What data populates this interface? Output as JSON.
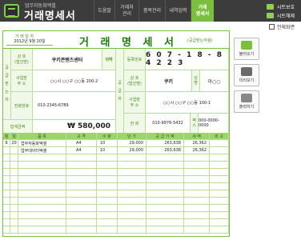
{
  "app": {
    "subtitle": "업무자동화엑셀",
    "title": "거래명세서"
  },
  "nav": {
    "tabs": [
      {
        "label": "도움말"
      },
      {
        "label": "거래처\n관리"
      },
      {
        "label": "품목관리"
      },
      {
        "label": "내역입력"
      },
      {
        "label": "거래\n명세서"
      }
    ],
    "sheet_protect": "시트보호",
    "sheet_unprotect": "시트해제"
  },
  "fullscreen_label": "전체화면",
  "invoice": {
    "date_label": "거 래 일 자",
    "date_value": "2012년 9월 20일",
    "title": "거 래 명 세 서",
    "receiver_note": "(공급받는자용)",
    "left_side_label": "공\n급\n받\n는\n자",
    "right_side_label": "공\n급\n자",
    "buyer": {
      "name_label": "상 호\n(법인명)",
      "name": "쿠키콘텐츠센터",
      "honorific": "귀하",
      "addr_label": "사업장\n주 소",
      "addr": "○○시 ○○구 ○○동 200-2",
      "phone_label": "전화번호",
      "phone": "010-2345-6789",
      "total_label": "합계금액",
      "total": "₩ 580,000"
    },
    "supplier": {
      "regno_label": "등록번호",
      "regno": "6 0 7 - 1 8 - 8 4 2 2 3",
      "name_label": "상 호\n(법인명)",
      "name": "쿠키",
      "ceo_label": "성\n명",
      "ceo": "아○○",
      "addr_label": "사업장\n주 소",
      "addr": "○○시 ○○구 ○○동 100-1",
      "phone_label": "전 화",
      "phone": "010-9876-5432",
      "fax_label": "팩\n스",
      "fax": "000-0000-0000"
    },
    "columns": [
      "월",
      "일",
      "품 목",
      "규 격",
      "수 량",
      "단 가",
      "공 급 가 액",
      "세 액",
      "비 고"
    ],
    "items": [
      {
        "month": "9",
        "day": "20",
        "name": "업무자동화엑셀",
        "spec": "A4",
        "qty": "10",
        "price": "29,000",
        "amount": "263,638",
        "tax": "26,362",
        "note": ""
      },
      {
        "month": "",
        "day": "",
        "name": "업무데이터엑셀",
        "spec": "A4",
        "qty": "10",
        "price": "29,000",
        "amount": "263,638",
        "tax": "26,362",
        "note": ""
      }
    ]
  },
  "actions": {
    "load": "불러오기",
    "preview": "미리보기",
    "print": "출력하기"
  }
}
